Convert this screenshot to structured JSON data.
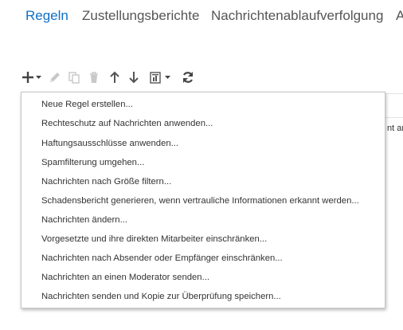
{
  "tabs": [
    {
      "label": "Regeln",
      "active": true
    },
    {
      "label": "Zustellungsberichte",
      "active": false
    },
    {
      "label": "Nachrichtenablaufverfolgung",
      "active": false
    },
    {
      "label": "A",
      "active": false
    }
  ],
  "toolbar": {
    "icons": [
      "plus-icon",
      "chevron-down-icon",
      "pencil-icon",
      "copy-icon",
      "trash-icon",
      "arrow-up-icon",
      "arrow-down-icon",
      "report-icon",
      "chevron-down-icon",
      "refresh-icon"
    ]
  },
  "background": {
    "truncated_text": "nt an"
  },
  "menu": {
    "items": [
      "Neue Regel erstellen...",
      "Rechteschutz auf Nachrichten anwenden...",
      "Haftungsausschlüsse anwenden...",
      "Spamfilterung umgehen...",
      "Nachrichten nach Größe filtern...",
      "Schadensbericht generieren, wenn vertrauliche Informationen erkannt werden...",
      "Nachrichten ändern...",
      "Vorgesetzte und ihre direkten Mitarbeiter einschränken...",
      "Nachrichten nach Absender oder Empfänger einschränken...",
      "Nachrichten an einen Moderator senden...",
      "Nachrichten senden und Kopie zur Überprüfung speichern..."
    ]
  },
  "colors": {
    "accent": "#0f6fc6",
    "tab_inactive": "#555555",
    "icon_dark": "#444444",
    "icon_disabled": "#c8c8c8"
  }
}
